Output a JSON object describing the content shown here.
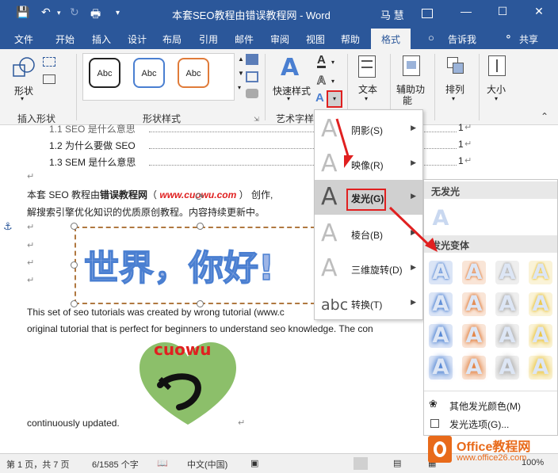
{
  "titlebar": {
    "title": "本套SEO教程由错误教程网  -  Word",
    "user": "马 慧"
  },
  "tabs": [
    "文件",
    "开始",
    "插入",
    "设计",
    "布局",
    "引用",
    "邮件",
    "审阅",
    "视图",
    "帮助",
    "格式",
    "告诉我",
    "共享"
  ],
  "ribbon": {
    "insert_shape_label": "形状",
    "group_insert_shapes": "插入形状",
    "swatch_text": "Abc",
    "group_shape_styles": "形状样式",
    "quick_styles": "快速样式",
    "group_art": "艺术字样",
    "text_label": "文本",
    "aux_label": "辅助功",
    "aux_label2": "能",
    "arrange_label": "排列",
    "size_label": "大小"
  },
  "doc": {
    "toc1": "1.1 SEO 是什么意思",
    "toc2": "1.2  为什么要做 SEO",
    "toc3": "1.3 SEM 是什么意思",
    "toc_page": "1",
    "para1a": "本套 SEO 教程由",
    "para1b": "错误教程网",
    "para1c": "（ ",
    "para1d": "www.cuowu.com",
    "para1e": " ） 创作,",
    "para2": "解搜索引擎优化知识的优质原创教程。内容持续更新中。",
    "wordart": "世界，你好!",
    "en1": "This set of seo tutorials was created by wrong tutorial (www.c",
    "en2": "original tutorial that is perfect for beginners to understand seo knowledge. The con",
    "logo_text": "cuowu",
    "en3": "continuously updated."
  },
  "menu": [
    {
      "label": "阴影(S)",
      "glyph": "A"
    },
    {
      "label": "映像(R)",
      "glyph": "A"
    },
    {
      "label": "发光(G)",
      "glyph": "A"
    },
    {
      "label": "棱台(B)",
      "glyph": "A"
    },
    {
      "label": "三维旋转(D)",
      "glyph": "A"
    },
    {
      "label": "转换(T)",
      "glyph": "abc"
    }
  ],
  "submenu": {
    "no_glow": "无发光",
    "variants": "发光变体",
    "more_colors": "其他发光颜色(M)",
    "options": "发光选项(G)...",
    "glyph": "A"
  },
  "glow_colors": [
    [
      "#4a7fd1",
      "#e07b39",
      "#a8a8a8",
      "#e8c23a"
    ],
    [
      "#4a7fd1",
      "#e07b39",
      "#a8a8a8",
      "#e8c23a"
    ],
    [
      "#4a7fd1",
      "#e07b39",
      "#a8a8a8",
      "#e8c23a"
    ],
    [
      "#4a7fd1",
      "#e07b39",
      "#a8a8a8",
      "#e8c23a"
    ]
  ],
  "status": {
    "page": "第 1 页，共 7 页",
    "words": "6/1585 个字",
    "lang": "中文(中国)",
    "zoom": "100%"
  },
  "watermark": {
    "brand": "Office教程网",
    "url": "www.office26.com"
  },
  "colors": {
    "accent": "#2b579a",
    "red": "#e02020"
  }
}
